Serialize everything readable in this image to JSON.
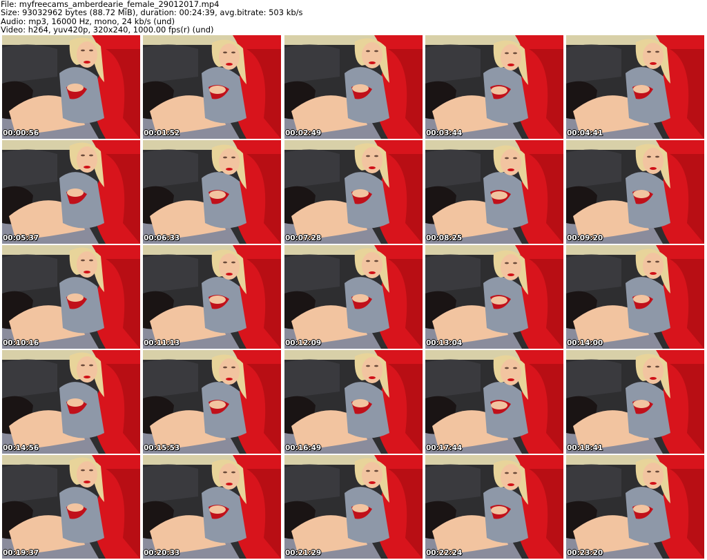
{
  "header": {
    "file_line": "File: myfreecams_amberdearie_female_29012017.mp4",
    "size_line": "Size: 93032962 bytes (88.72 MiB), duration: 00:24:39, avg.bitrate: 503 kb/s",
    "audio_line": "Audio: mp3, 16000 Hz, mono, 24 kb/s (und)",
    "video_line": "Video: h264, yuv420p, 320x240, 1000.00 fps(r) (und)"
  },
  "thumbnails": [
    {
      "timestamp": "00:00:56"
    },
    {
      "timestamp": "00:01:52"
    },
    {
      "timestamp": "00:02:49"
    },
    {
      "timestamp": "00:03:44"
    },
    {
      "timestamp": "00:04:41"
    },
    {
      "timestamp": "00:05:37"
    },
    {
      "timestamp": "00:06:33"
    },
    {
      "timestamp": "00:07:28"
    },
    {
      "timestamp": "00:08:25"
    },
    {
      "timestamp": "00:09:20"
    },
    {
      "timestamp": "00:10:16"
    },
    {
      "timestamp": "00:11:13"
    },
    {
      "timestamp": "00:12:09"
    },
    {
      "timestamp": "00:13:04"
    },
    {
      "timestamp": "00:14:00"
    },
    {
      "timestamp": "00:14:56"
    },
    {
      "timestamp": "00:15:53"
    },
    {
      "timestamp": "00:16:49"
    },
    {
      "timestamp": "00:17:44"
    },
    {
      "timestamp": "00:18:41"
    },
    {
      "timestamp": "00:19:37"
    },
    {
      "timestamp": "00:20:33"
    },
    {
      "timestamp": "00:21:29"
    },
    {
      "timestamp": "00:22:24"
    },
    {
      "timestamp": "00:23:20"
    }
  ],
  "colors": {
    "background": "#ffffff",
    "couch_red": "#d8141c",
    "couch_dark": "#2e2e30",
    "cushion_grey": "#8a8c9c",
    "skin": "#f2c4a0",
    "hair": "#e8d49a",
    "dress_grey": "#8e98a8",
    "bra_red": "#c0101a",
    "stocking_black": "#1a1414"
  }
}
